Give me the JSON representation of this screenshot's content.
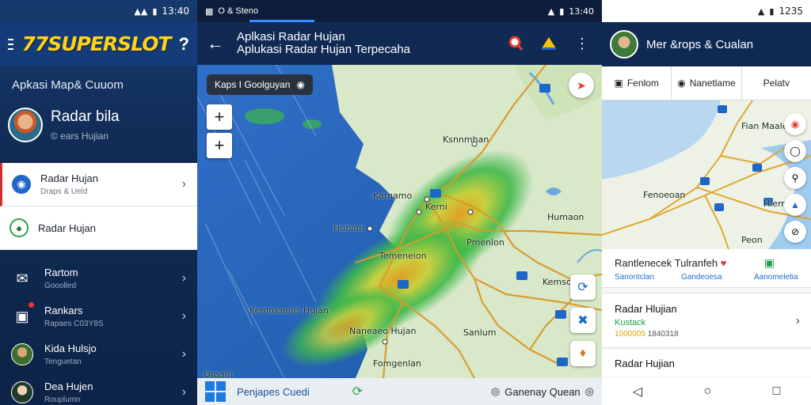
{
  "panel1": {
    "status_time": "13:40",
    "brand": "77SUPERSLOT",
    "help_icon": "?",
    "section_title": "Apkasi Map& Cuuom",
    "profile": {
      "name": "Radar bila",
      "sub": "© ears Hujian"
    },
    "menu_card": [
      {
        "title": "Radar Hujan",
        "sub": "Draps & Ueld"
      },
      {
        "title": "Radar Hujan",
        "sub": ""
      }
    ],
    "nav": [
      {
        "title": "Rartom",
        "sub": "Gooolled"
      },
      {
        "title": "Rankars",
        "sub": "Rapaes C03Y8S"
      },
      {
        "title": "Kida Hulsjo",
        "sub": "Tenguetan"
      },
      {
        "title": "Dea Hujen",
        "sub": "Rouplumn"
      }
    ]
  },
  "panel2": {
    "status_left": "O & Steno",
    "status_time": "13:40",
    "title_line1": "Aplkasi Radar Hujan",
    "title_line2": "Aplukasi Radar Hujan Terpecaha",
    "chip": "Kaps  I Goolguyan",
    "map_labels": [
      "Ksnnmhan",
      "Karnamo",
      "Kerni",
      "Hubian",
      "Humaon",
      "Temeneion",
      "Pmenlon",
      "Kemsom",
      "Kemmannis Hujan",
      "Naneaeo Hujan",
      "Fomgenlan",
      "Sanlum",
      "Oraaln"
    ],
    "bottom_left": "Penjapes Cuedi",
    "bottom_right": "Ganenay Quean"
  },
  "panel3": {
    "status_time": "1235",
    "header_title": "Mer &rops & Cualan",
    "tabs": [
      "Fenlom",
      "Nanetlame",
      "Pelatv"
    ],
    "map_labels": [
      "Fian Maale",
      "Fenoeoan",
      "Hlemt",
      "Peon"
    ],
    "info": {
      "title": "Rantlenecek Tulranfeh",
      "links": [
        "Sanontclan",
        "Gandeoesa",
        "Aanomeletia"
      ]
    },
    "card": {
      "title": "Radar Hlujian",
      "green": "Kustack",
      "yellow": "1000005",
      "gray": "1840318"
    },
    "row": "Radar Hujian"
  }
}
